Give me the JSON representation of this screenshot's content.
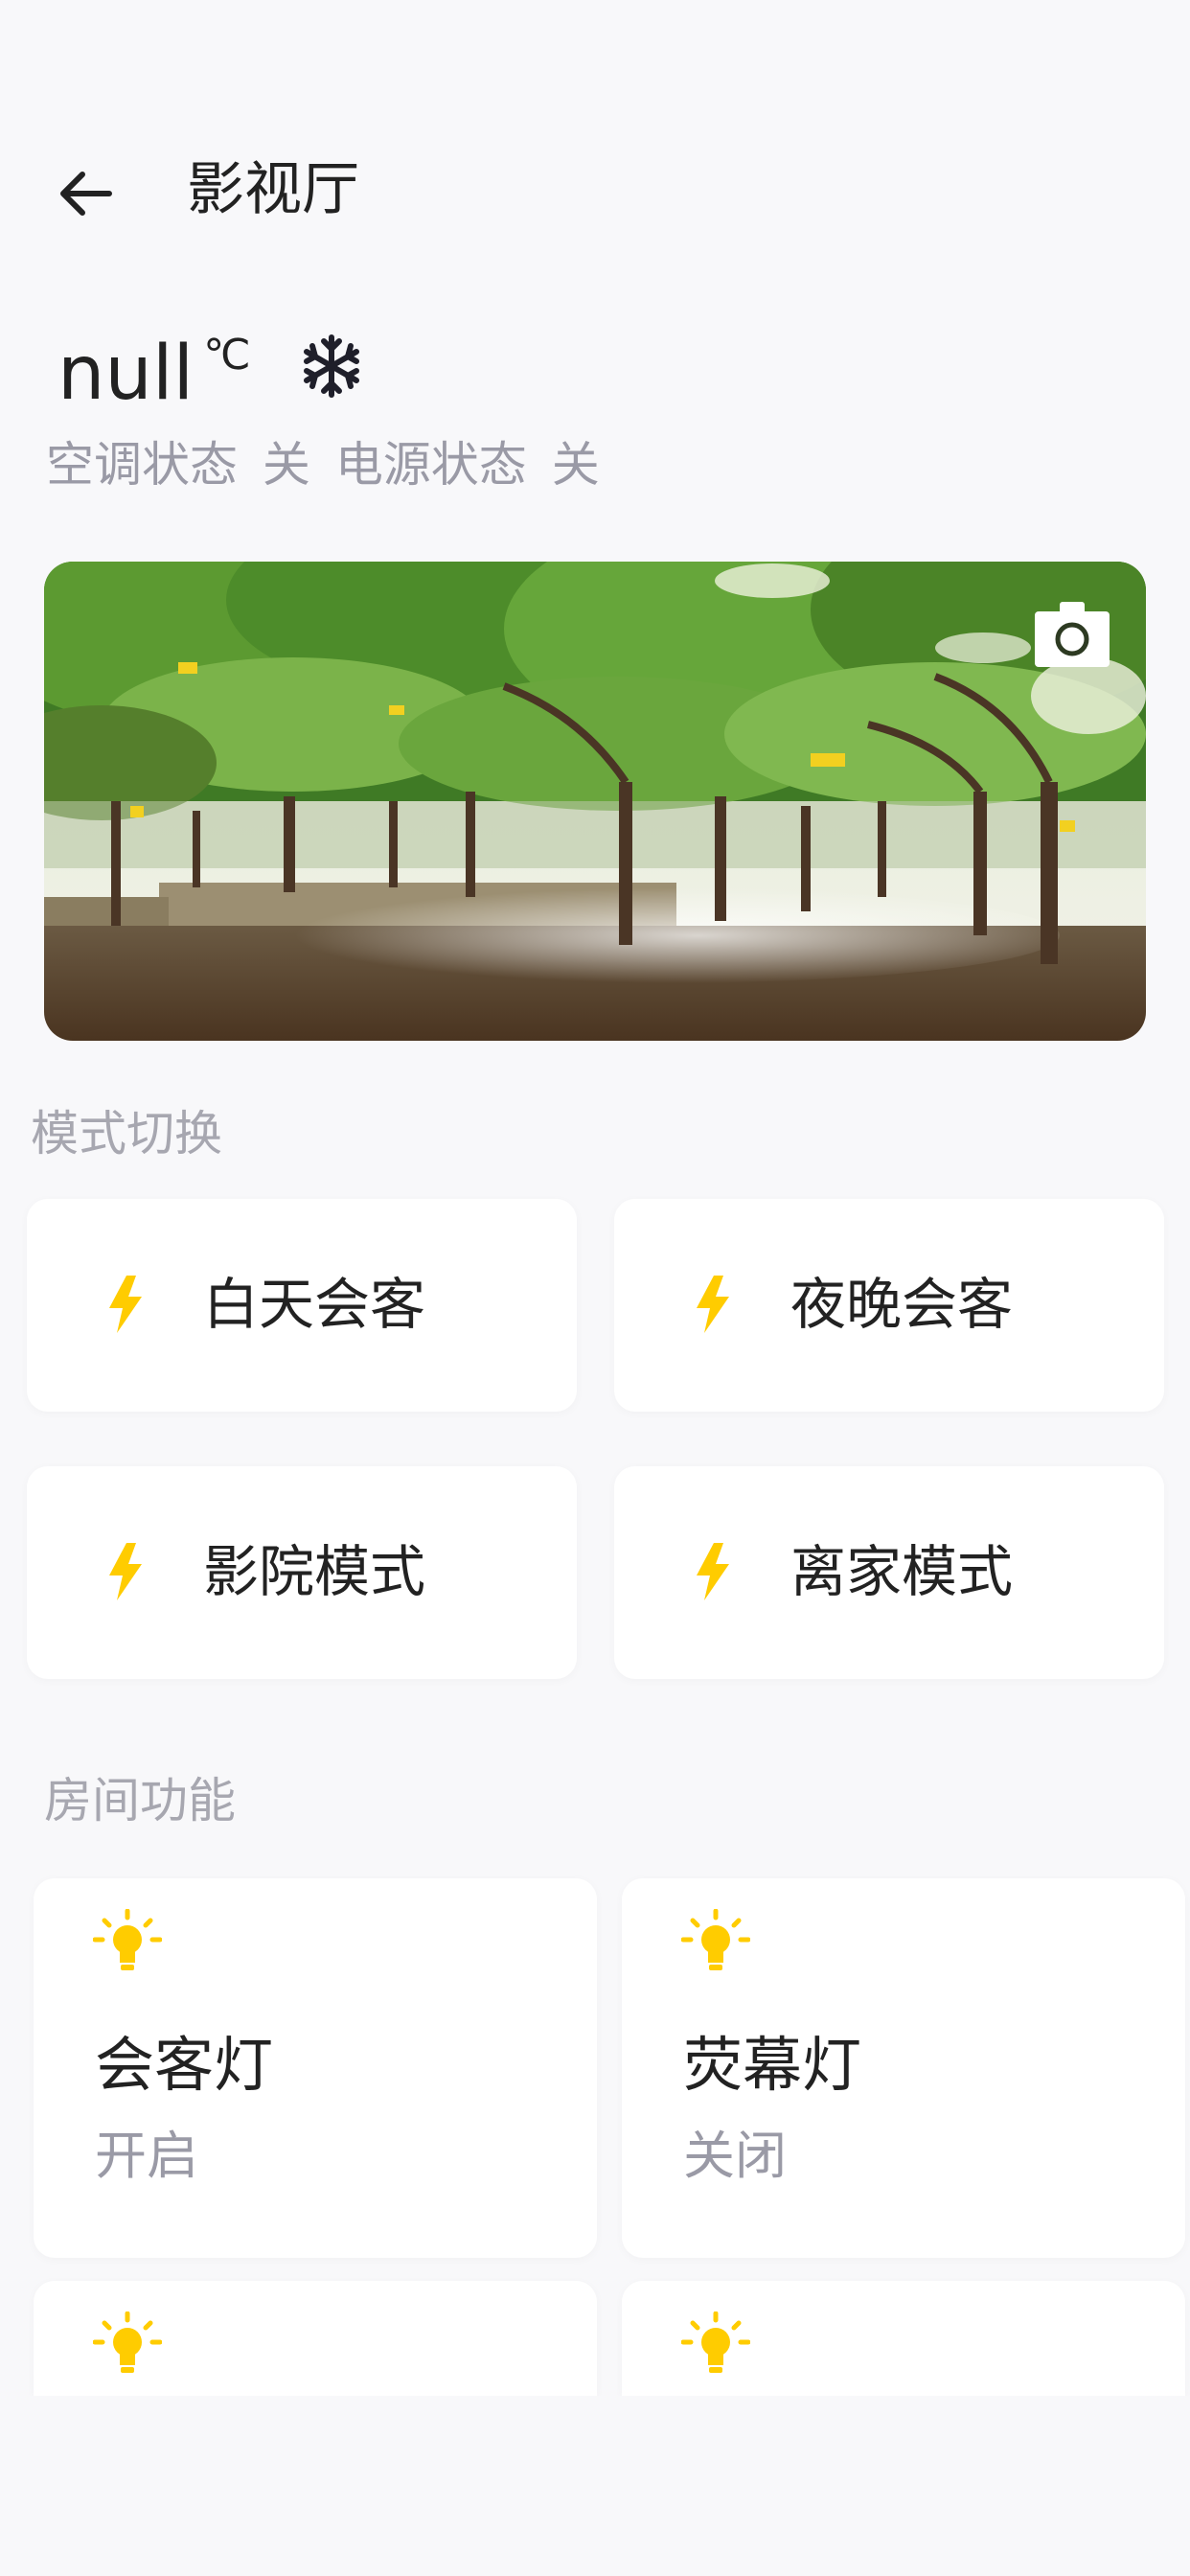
{
  "header": {
    "title": "影视厅",
    "back_icon": "arrow-left-icon"
  },
  "climate": {
    "temperature": "null",
    "unit": "℃",
    "mode_icon": "snowflake-icon",
    "ac_status_label": "空调状态",
    "ac_status_value": "关",
    "power_status_label": "电源状态",
    "power_status_value": "关"
  },
  "camera": {
    "icon": "camera-icon"
  },
  "modes": {
    "section_title": "模式切换",
    "items": [
      {
        "label": "白天会客",
        "icon": "lightning-icon"
      },
      {
        "label": "夜晚会客",
        "icon": "lightning-icon"
      },
      {
        "label": "影院模式",
        "icon": "lightning-icon"
      },
      {
        "label": "离家模式",
        "icon": "lightning-icon"
      }
    ]
  },
  "functions": {
    "section_title": "房间功能",
    "items": [
      {
        "name": "会客灯",
        "state": "开启",
        "icon": "lightbulb-icon"
      },
      {
        "name": "荧幕灯",
        "state": "关闭",
        "icon": "lightbulb-icon"
      },
      {
        "name": "",
        "state": "",
        "icon": "lightbulb-icon"
      },
      {
        "name": "",
        "state": "",
        "icon": "lightbulb-icon"
      }
    ]
  },
  "colors": {
    "accent_yellow": "#ffcc00",
    "background": "#f8f8fa",
    "card": "#ffffff",
    "text_primary": "#222222",
    "text_secondary": "#9a9aa6"
  }
}
